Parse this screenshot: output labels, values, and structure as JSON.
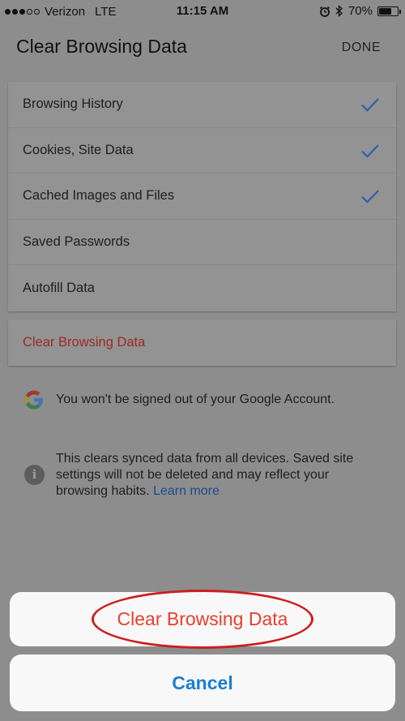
{
  "status_bar": {
    "carrier": "Verizon",
    "network": "LTE",
    "time": "11:15 AM",
    "battery_percent": "70%",
    "battery_level": 0.7,
    "signal_dots_filled": 3,
    "signal_dots_total": 5
  },
  "header": {
    "title": "Clear Browsing Data",
    "done_label": "DONE"
  },
  "options": [
    {
      "label": "Browsing History",
      "checked": true
    },
    {
      "label": "Cookies, Site Data",
      "checked": true
    },
    {
      "label": "Cached Images and Files",
      "checked": true
    },
    {
      "label": "Saved Passwords",
      "checked": false
    },
    {
      "label": "Autofill Data",
      "checked": false
    }
  ],
  "clear_row": {
    "label": "Clear Browsing Data"
  },
  "info": {
    "google_note": "You won't be signed out of your Google Account.",
    "sync_note": "This clears synced data from all devices. Saved site settings will not be deleted and may reflect your browsing habits.",
    "learn_more": "Learn more"
  },
  "action_sheet": {
    "clear_label": "Clear Browsing Data",
    "cancel_label": "Cancel"
  },
  "colors": {
    "checkmark": "#2f5fae",
    "destructive": "#e3412f",
    "link": "#1c4a89",
    "annotation": "#cc1f1f"
  }
}
